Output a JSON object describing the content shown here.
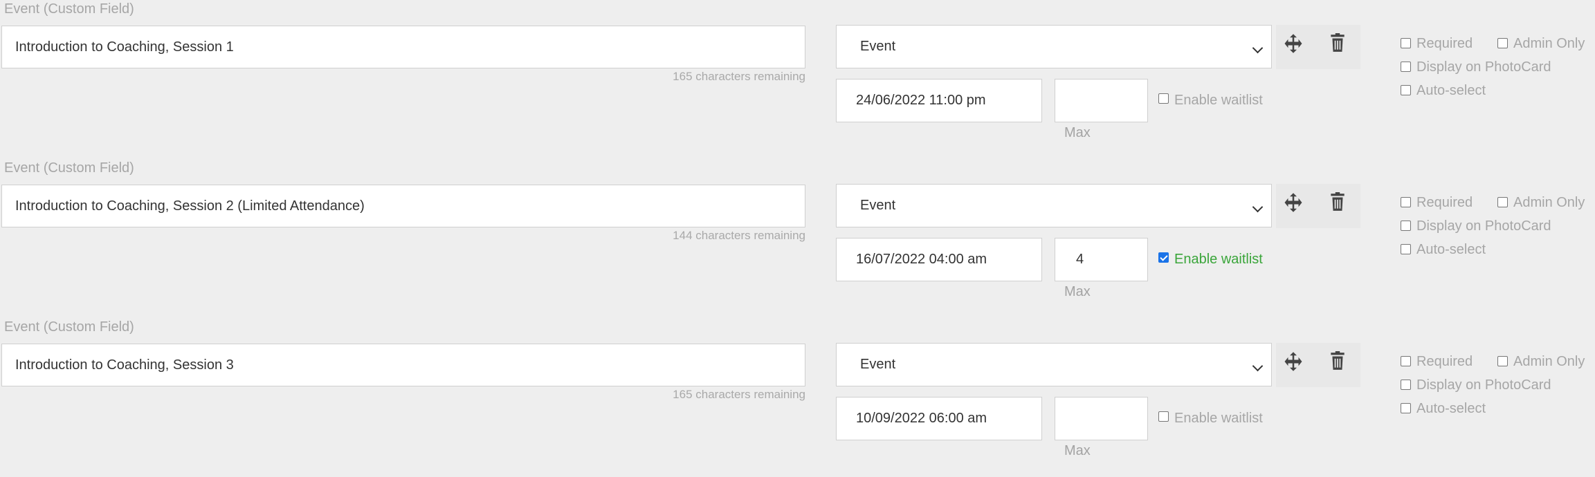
{
  "events": [
    {
      "field_label": "Event (Custom Field)",
      "name": "Introduction to Coaching, Session 1",
      "chars_remaining": "165 characters remaining",
      "type": "Event",
      "datetime": "24/06/2022 11:00 pm",
      "max": "",
      "max_label": "Max",
      "waitlist_label": "Enable waitlist",
      "waitlist_enabled": false,
      "options": {
        "required": "Required",
        "admin_only": "Admin Only",
        "display_photocard": "Display on PhotoCard",
        "auto_select": "Auto-select"
      }
    },
    {
      "field_label": "Event (Custom Field)",
      "name": "Introduction to Coaching, Session 2 (Limited Attendance)",
      "chars_remaining": "144 characters remaining",
      "type": "Event",
      "datetime": "16/07/2022 04:00 am",
      "max": "4",
      "max_label": "Max",
      "waitlist_label": "Enable waitlist",
      "waitlist_enabled": true,
      "options": {
        "required": "Required",
        "admin_only": "Admin Only",
        "display_photocard": "Display on PhotoCard",
        "auto_select": "Auto-select"
      }
    },
    {
      "field_label": "Event (Custom Field)",
      "name": "Introduction to Coaching, Session 3",
      "chars_remaining": "165 characters remaining",
      "type": "Event",
      "datetime": "10/09/2022 06:00 am",
      "max": "",
      "max_label": "Max",
      "waitlist_label": "Enable waitlist",
      "waitlist_enabled": false,
      "options": {
        "required": "Required",
        "admin_only": "Admin Only",
        "display_photocard": "Display on PhotoCard",
        "auto_select": "Auto-select"
      }
    }
  ],
  "icons": {
    "move": "move-arrows-icon",
    "delete": "trash-icon"
  },
  "colors": {
    "background": "#eeeeee",
    "waitlist_active": "#3aa53a",
    "checkbox_checked": "#1a73e8",
    "muted_text": "#a6a6a6"
  }
}
